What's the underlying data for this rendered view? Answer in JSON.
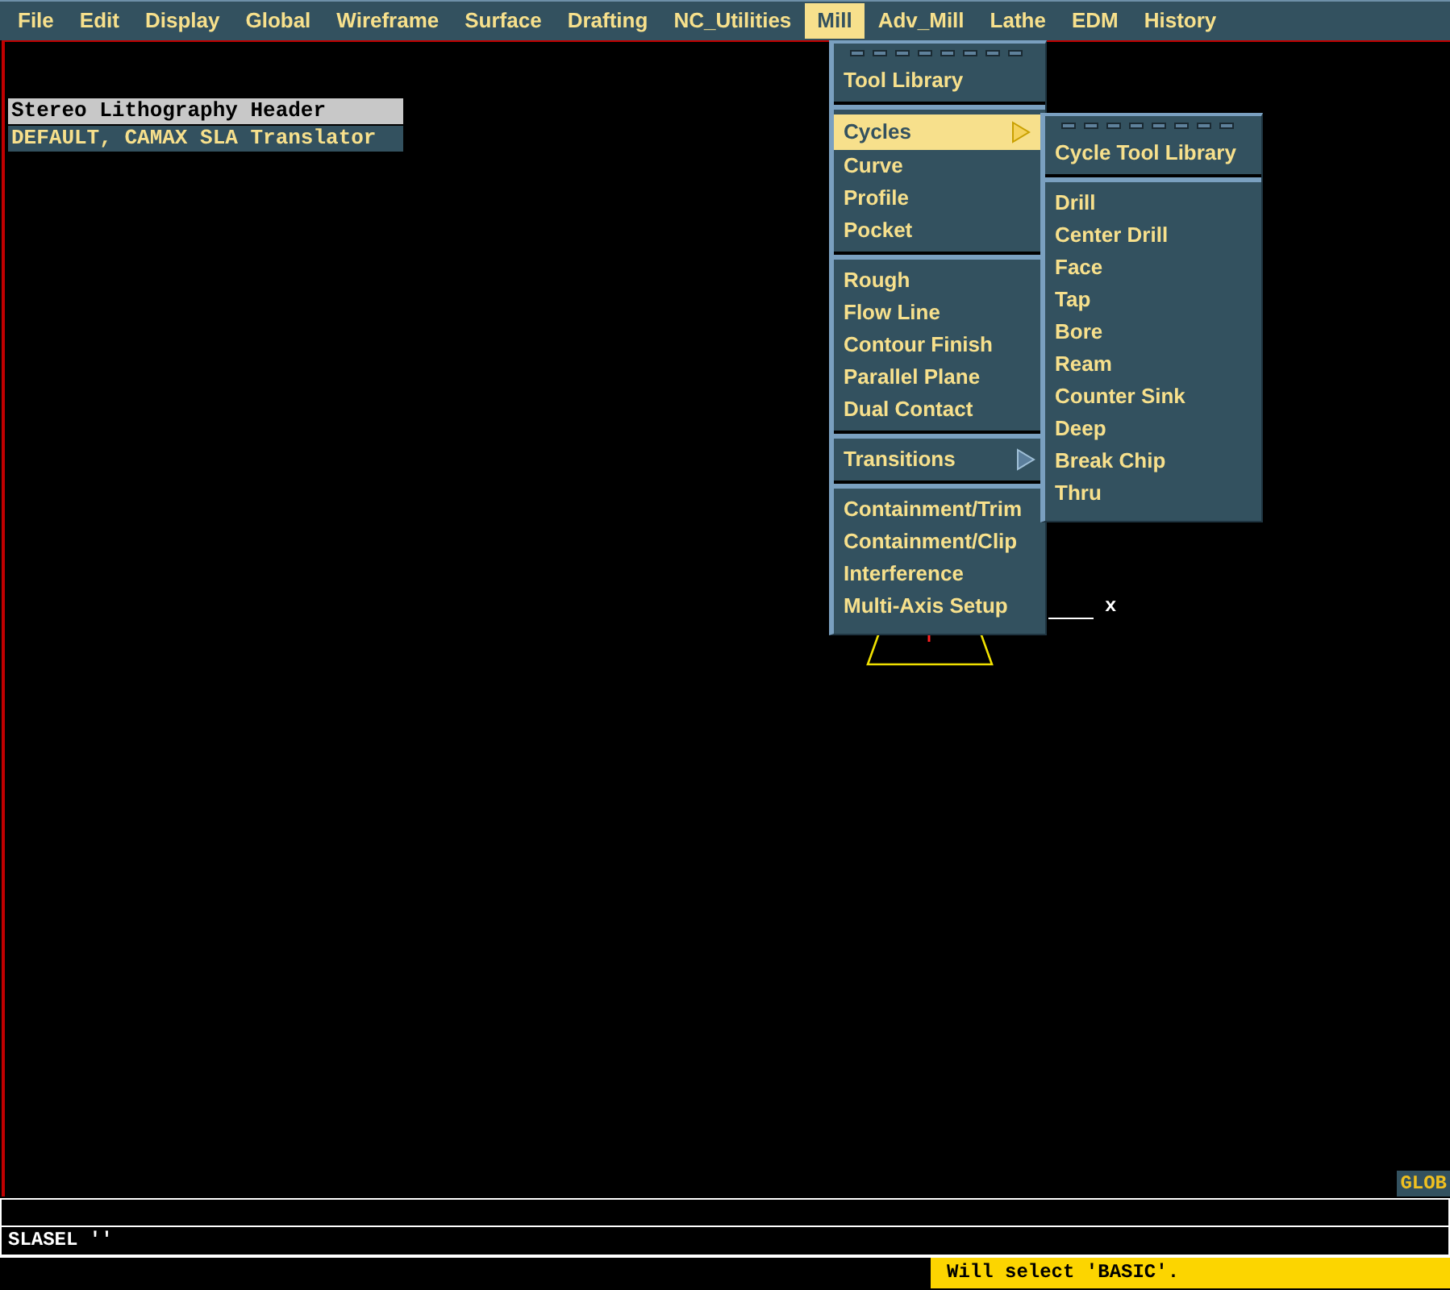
{
  "menu_bar": [
    {
      "label": "File",
      "selected": false
    },
    {
      "label": "Edit",
      "selected": false
    },
    {
      "label": "Display",
      "selected": false
    },
    {
      "label": "Global",
      "selected": false
    },
    {
      "label": "Wireframe",
      "selected": false
    },
    {
      "label": "Surface",
      "selected": false
    },
    {
      "label": "Drafting",
      "selected": false
    },
    {
      "label": "NC_Utilities",
      "selected": false
    },
    {
      "label": "Mill",
      "selected": true
    },
    {
      "label": "Adv_Mill",
      "selected": false
    },
    {
      "label": "Lathe",
      "selected": false
    },
    {
      "label": "EDM",
      "selected": false
    },
    {
      "label": "History",
      "selected": false
    }
  ],
  "header_panel": {
    "title": "Stereo Lithography Header",
    "value": "DEFAULT, CAMAX SLA Translator"
  },
  "mill_menu": {
    "groups": [
      [
        {
          "label": "Tool Library",
          "selected": false,
          "submenu": false
        }
      ],
      [
        {
          "label": "Cycles",
          "selected": true,
          "submenu": true
        },
        {
          "label": "Curve",
          "selected": false,
          "submenu": false
        },
        {
          "label": "Profile",
          "selected": false,
          "submenu": false
        },
        {
          "label": "Pocket",
          "selected": false,
          "submenu": false
        }
      ],
      [
        {
          "label": "Rough",
          "selected": false,
          "submenu": false
        },
        {
          "label": "Flow Line",
          "selected": false,
          "submenu": false
        },
        {
          "label": "Contour Finish",
          "selected": false,
          "submenu": false
        },
        {
          "label": "Parallel Plane",
          "selected": false,
          "submenu": false
        },
        {
          "label": "Dual Contact",
          "selected": false,
          "submenu": false
        }
      ],
      [
        {
          "label": "Transitions",
          "selected": false,
          "submenu": true
        }
      ],
      [
        {
          "label": "Containment/Trim",
          "selected": false,
          "submenu": false
        },
        {
          "label": "Containment/Clip",
          "selected": false,
          "submenu": false
        },
        {
          "label": "Interference",
          "selected": false,
          "submenu": false
        },
        {
          "label": "Multi-Axis Setup",
          "selected": false,
          "submenu": false
        }
      ]
    ]
  },
  "cycles_submenu": {
    "groups": [
      [
        {
          "label": "Cycle Tool Library",
          "selected": false,
          "submenu": false
        }
      ],
      [
        {
          "label": "Drill",
          "selected": false,
          "submenu": false
        },
        {
          "label": "Center Drill",
          "selected": false,
          "submenu": false
        },
        {
          "label": "Face",
          "selected": false,
          "submenu": false
        },
        {
          "label": "Tap",
          "selected": false,
          "submenu": false
        },
        {
          "label": "Bore",
          "selected": false,
          "submenu": false
        },
        {
          "label": "Ream",
          "selected": false,
          "submenu": false
        },
        {
          "label": "Counter Sink",
          "selected": false,
          "submenu": false
        },
        {
          "label": "Deep",
          "selected": false,
          "submenu": false
        },
        {
          "label": "Break Chip",
          "selected": false,
          "submenu": false
        },
        {
          "label": "Thru",
          "selected": false,
          "submenu": false
        }
      ]
    ]
  },
  "viewport": {
    "axis_label": "x",
    "badge": "GLOB"
  },
  "command_line": {
    "echo": "SLASEL ''"
  },
  "status_message": "Will select 'BASIC'."
}
